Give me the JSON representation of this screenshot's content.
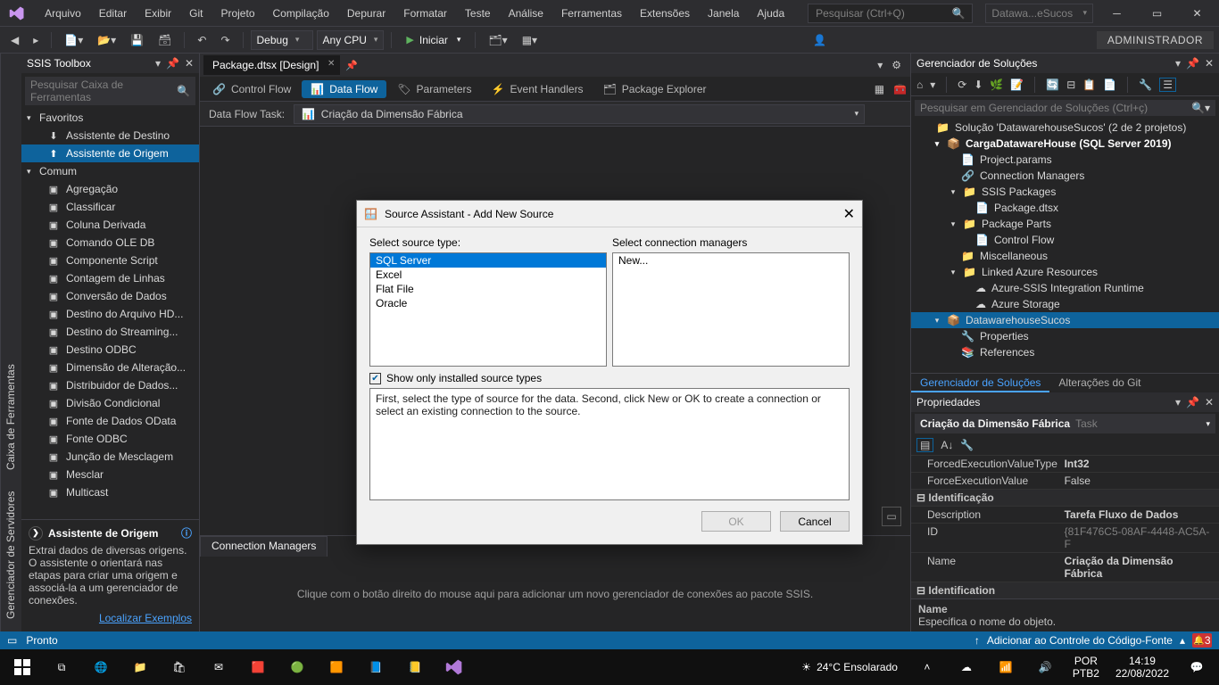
{
  "menu": [
    "Arquivo",
    "Editar",
    "Exibir",
    "Git",
    "Projeto",
    "Compilação",
    "Depurar",
    "Formatar",
    "Teste",
    "Análise",
    "Ferramentas",
    "Extensões",
    "Janela",
    "Ajuda"
  ],
  "global_search_placeholder": "Pesquisar (Ctrl+Q)",
  "recent_project": "Datawa...eSucos",
  "toolbar": {
    "config": "Debug",
    "platform": "Any CPU",
    "start": "Iniciar",
    "admin": "ADMINISTRADOR"
  },
  "left_rail": [
    "Gerenciador de Servidores",
    "Caixa de Ferramentas"
  ],
  "toolbox": {
    "title": "SSIS Toolbox",
    "search_placeholder": "Pesquisar Caixa de Ferramentas",
    "cat_fav": "Favoritos",
    "fav": [
      "Assistente de Destino",
      "Assistente de Origem"
    ],
    "cat_common": "Comum",
    "common": [
      "Agregação",
      "Classificar",
      "Coluna Derivada",
      "Comando OLE DB",
      "Componente Script",
      "Contagem de Linhas",
      "Conversão de Dados",
      "Destino do Arquivo HD...",
      "Destino do Streaming...",
      "Destino ODBC",
      "Dimensão de Alteração...",
      "Distribuidor de Dados...",
      "Divisão Condicional",
      "Fonte de Dados OData",
      "Fonte ODBC",
      "Junção de Mesclagem",
      "Mesclar",
      "Multicast"
    ],
    "help_title": "Assistente de Origem",
    "help_text": "Extrai dados de diversas origens. O assistente o orientará nas etapas para criar uma origem e associá-la a um gerenciador de conexões.",
    "help_link": "Localizar Exemplos"
  },
  "document": {
    "tab": "Package.dtsx [Design]"
  },
  "designer_tabs": {
    "control": "Control Flow",
    "data": "Data Flow",
    "param": "Parameters",
    "events": "Event Handlers",
    "explorer": "Package Explorer"
  },
  "df": {
    "label": "Data Flow Task:",
    "value": "Criação da Dimensão Fábrica"
  },
  "connmgr": {
    "tab": "Connection Managers",
    "hint": "Clique com o botão direito do mouse aqui para adicionar um novo gerenciador de conexões ao pacote SSIS."
  },
  "solution": {
    "title": "Gerenciador de Soluções",
    "search_placeholder": "Pesquisar em Gerenciador de Soluções (Ctrl+ç)",
    "root": "Solução 'DatawarehouseSucos' (2 de 2 projetos)",
    "proj": "CargaDatawareHouse (SQL Server 2019)",
    "items": [
      "Project.params",
      "Connection Managers",
      "SSIS Packages",
      "Package.dtsx",
      "Package Parts",
      "Control Flow",
      "Miscellaneous",
      "Linked Azure Resources",
      "Azure-SSIS Integration Runtime",
      "Azure Storage"
    ],
    "proj2": "DatawarehouseSucos",
    "items2": [
      "Properties",
      "References"
    ],
    "tab_sol": "Gerenciador de Soluções",
    "tab_git": "Alterações do Git"
  },
  "props": {
    "title": "Propriedades",
    "sel": "Criação da Dimensão Fábrica",
    "sel_type": "Task",
    "rows": [
      {
        "k": "ForcedExecutionValueType",
        "v": "Int32",
        "bold": true
      },
      {
        "k": "ForceExecutionValue",
        "v": "False"
      }
    ],
    "cat": "Identificação",
    "rows2": [
      {
        "k": "Description",
        "v": "Tarefa Fluxo de Dados",
        "bold": true
      },
      {
        "k": "ID",
        "v": "{81F476C5-08AF-4448-AC5A-F",
        "ro": true
      },
      {
        "k": "Name",
        "v": "Criação da Dimensão Fábrica",
        "bold": true
      }
    ],
    "cat2": "Identification",
    "help_name": "Name",
    "help_text": "Especifica o nome do objeto."
  },
  "status": {
    "ready": "Pronto",
    "git": "Adicionar ao Controle do Código-Fonte",
    "notif": "3"
  },
  "taskbar": {
    "weather": "24°C  Ensolarado",
    "kbd": "POR",
    "kbd2": "PTB2",
    "time": "14:19",
    "date": "22/08/2022"
  },
  "dialog": {
    "title": "Source Assistant - Add New Source",
    "lbl_types": "Select source type:",
    "lbl_cm": "Select connection managers",
    "types": [
      "SQL Server",
      "Excel",
      "Flat File",
      "Oracle"
    ],
    "cms": [
      "New..."
    ],
    "chk": "Show only installed source types",
    "msg": "First, select the type of source for the data. Second, click New or OK to create a connection or select an existing connection to the source.",
    "ok": "OK",
    "cancel": "Cancel"
  }
}
